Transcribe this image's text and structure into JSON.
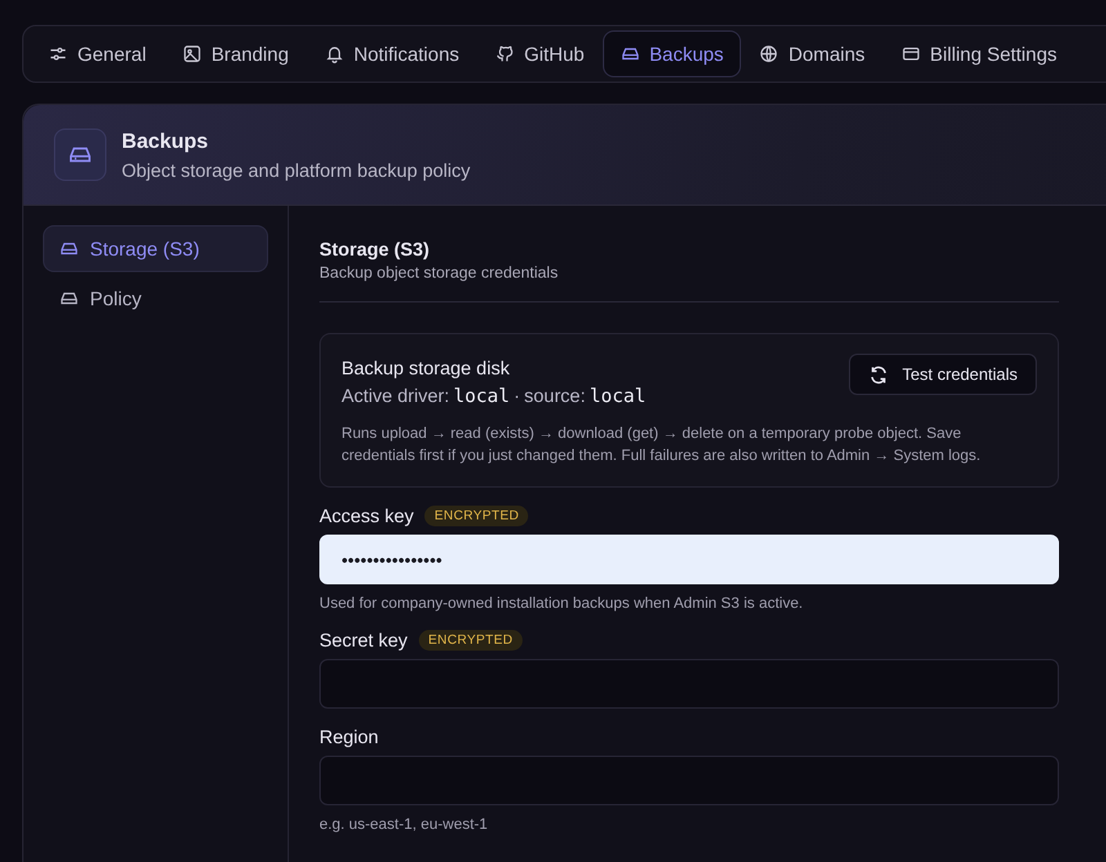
{
  "tabs": [
    {
      "label": "General",
      "selected": false
    },
    {
      "label": "Branding",
      "selected": false
    },
    {
      "label": "Notifications",
      "selected": false
    },
    {
      "label": "GitHub",
      "selected": false
    },
    {
      "label": "Backups",
      "selected": true
    },
    {
      "label": "Domains",
      "selected": false
    },
    {
      "label": "Billing Settings",
      "selected": false
    }
  ],
  "header": {
    "title": "Backups",
    "subtitle": "Object storage and platform backup policy"
  },
  "sidebar": {
    "items": [
      {
        "label": "Storage (S3)",
        "selected": true
      },
      {
        "label": "Policy",
        "selected": false
      }
    ]
  },
  "section": {
    "title": "Storage (S3)",
    "subtitle": "Backup object storage credentials"
  },
  "disk_card": {
    "title": "Backup storage disk",
    "driver_label": "Active driver:",
    "driver": "local",
    "separator": "·",
    "source_label": "source:",
    "source": "local",
    "description": "Runs upload → read (exists) → download (get) → delete on a temporary probe object. Save credentials first if you just changed them. Full failures are also written to Admin → System logs.",
    "button": "Test credentials"
  },
  "fields": [
    {
      "label": "Access key",
      "badge": "ENCRYPTED",
      "value": "••••••••••••••••",
      "autofilled": true,
      "hint": "Used for company-owned installation backups when Admin S3 is active."
    },
    {
      "label": "Secret key",
      "badge": "ENCRYPTED",
      "autofilled": false
    },
    {
      "label": "Region",
      "autofilled": false,
      "hint": "e.g. us-east-1, eu-west-1"
    }
  ]
}
